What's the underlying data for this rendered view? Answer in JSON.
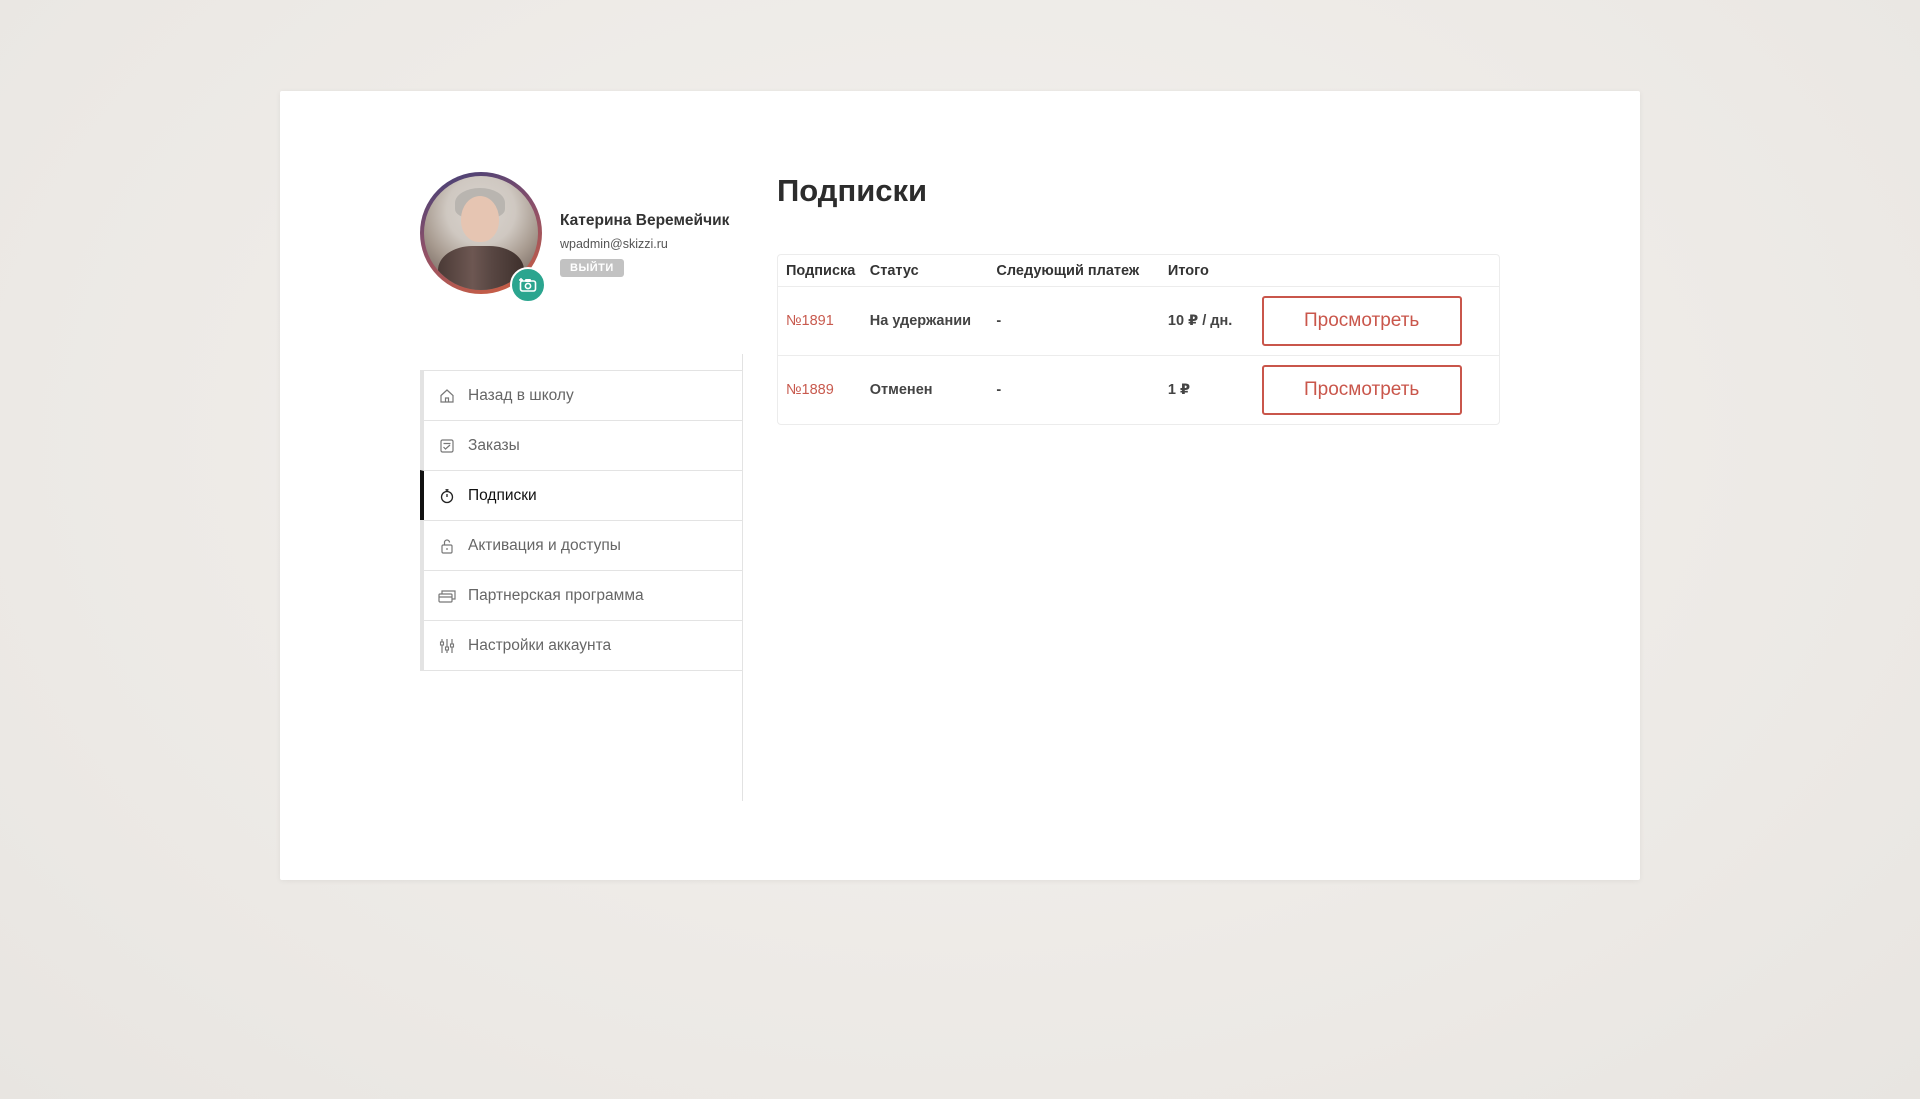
{
  "profile": {
    "name": "Катерина Веремейчик",
    "email": "wpadmin@skizzi.ru",
    "logout_label": "ВЫЙТИ",
    "camera_icon": "camera-add-icon"
  },
  "sidebar": {
    "items": [
      {
        "label": "Назад в школу",
        "icon": "home-icon",
        "active": false
      },
      {
        "label": "Заказы",
        "icon": "orders-icon",
        "active": false
      },
      {
        "label": "Подписки",
        "icon": "timer-icon",
        "active": true
      },
      {
        "label": "Активация и доступы",
        "icon": "unlock-icon",
        "active": false
      },
      {
        "label": "Партнерская программа",
        "icon": "cards-icon",
        "active": false
      },
      {
        "label": "Настройки аккаунта",
        "icon": "sliders-icon",
        "active": false
      }
    ]
  },
  "main": {
    "title": "Подписки",
    "table": {
      "headers": [
        "Подписка",
        "Статус",
        "Следующий платеж",
        "Итого"
      ],
      "rows": [
        {
          "id": "№1891",
          "status": "На удержании",
          "next_payment": "-",
          "total": "10 ₽ / дн.",
          "action": "Просмотреть"
        },
        {
          "id": "№1889",
          "status": "Отменен",
          "next_payment": "-",
          "total": "1 ₽",
          "action": "Просмотреть"
        }
      ]
    }
  },
  "colors": {
    "accent": "#c9564b",
    "camera_button": "#2ba58f",
    "active_border": "#111111"
  }
}
